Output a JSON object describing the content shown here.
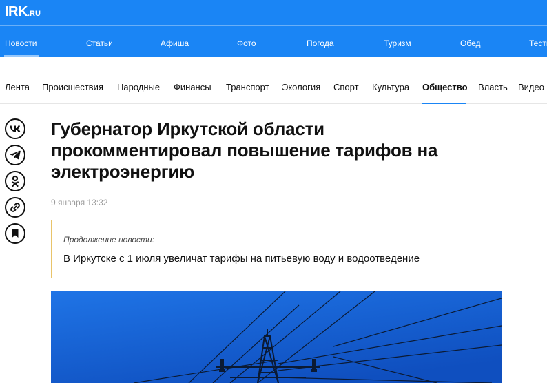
{
  "header": {
    "logo_main": "IRK",
    "logo_suffix": ".RU",
    "nav": [
      "Новости",
      "Статьи",
      "Афиша",
      "Фото",
      "Погода",
      "Туризм",
      "Обед",
      "Тесты"
    ],
    "active_nav": "Новости"
  },
  "subnav": {
    "items": [
      "Лента",
      "Происшествия",
      "Народные",
      "Финансы",
      "Транспорт",
      "Экология",
      "Спорт",
      "Культура",
      "Общество",
      "Власть",
      "Видео"
    ],
    "active": "Общество"
  },
  "share": [
    "vk-icon",
    "telegram-icon",
    "ok-icon",
    "link-icon",
    "bookmark-icon"
  ],
  "article": {
    "title": "Губернатор Иркутской области прокомментировал повышение тарифов на электроэнергию",
    "date": "9 января 13:32",
    "continuation_label": "Продолжение новости:",
    "continuation_link": "В Иркутске с 1 июля увеличат тарифы на питьевую воду и водоотведение"
  },
  "colors": {
    "header_bg": "#1a85f5",
    "quote_border": "#e9c46a",
    "sky": "#1565d8"
  }
}
